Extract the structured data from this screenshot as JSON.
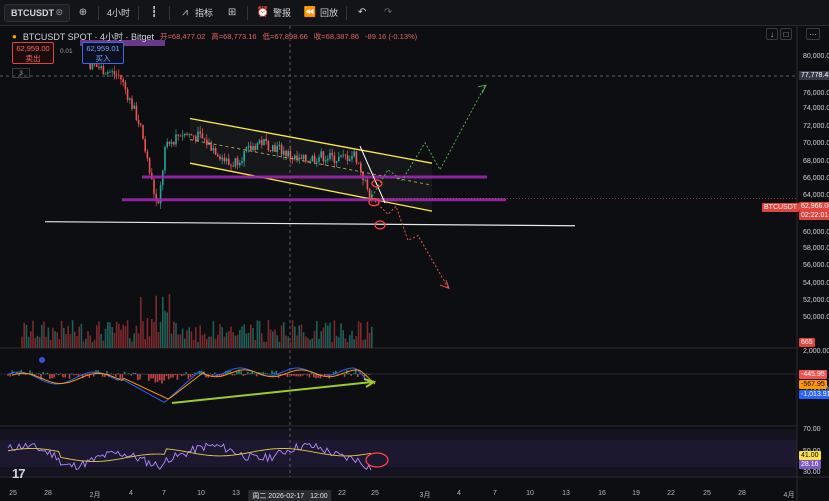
{
  "toolbar": {
    "symbol": "BTCUSDT",
    "interval": "4小时",
    "indicators_label": "指标",
    "alert_label": "警报",
    "replay_label": "回放"
  },
  "legend": {
    "title": "BTCUSDT SPOT · 4小时 · Bitget",
    "open": "开=68,477.02",
    "high": "高=68,773.16",
    "low": "低=67,898.66",
    "close": "收=68,387.86",
    "change": "-89.16 (-0.13%)",
    "sell_price": "62,959.00",
    "sell_label": "卖出",
    "spread": "0.01",
    "buy_price": "62,959.01",
    "buy_label": "买入",
    "collapse": "3"
  },
  "price_axis": {
    "labels": [
      "80,000.00",
      "76,000.00",
      "74,000.00",
      "72,000.00",
      "70,000.00",
      "68,000.00",
      "66,000.00",
      "64,000.00",
      "60,000.00",
      "58,000.00",
      "56,000.00",
      "54,000.00",
      "52,000.00",
      "50,000.00",
      "2,000.00",
      "-2,000.00",
      "70.00",
      "50.00",
      "30.00"
    ],
    "crosshair_price": "77,778.43",
    "last_price": "62,966.00",
    "countdown": "02:22:01",
    "symbol_tag": "BTCUSDT",
    "volume_tag": "665",
    "macd_values": [
      "-445.95",
      "-567.95",
      "-1,013.91"
    ],
    "rsi_values": [
      "41.00",
      "28.16"
    ]
  },
  "time_axis": {
    "labels": [
      "25",
      "28",
      "2月",
      "4",
      "7",
      "10",
      "13",
      "16",
      "19",
      "22",
      "25",
      "28",
      "3月",
      "4",
      "7",
      "10",
      "13",
      "16",
      "19",
      "22",
      "25",
      "28",
      "4月"
    ],
    "crosshair_date": "周二 2026-02-17",
    "crosshair_time": "12:00",
    "extra": [
      "22",
      "25"
    ]
  },
  "colors": {
    "up": "#26a69a",
    "down": "#ef5350",
    "channel": "#ffeb3b",
    "support": "#9c27b0",
    "macd_signal": "#9ccc2c",
    "rsi_line": "#b388ff",
    "rsi_signal": "#e6c84a"
  },
  "icons": {
    "add": "plus-circle-icon",
    "candles": "candles-icon",
    "indicators": "chart-indicators-icon",
    "layout": "grid-icon",
    "alert": "alarm-icon",
    "replay": "rewind-icon",
    "undo": "undo-icon",
    "redo": "redo-icon"
  }
}
